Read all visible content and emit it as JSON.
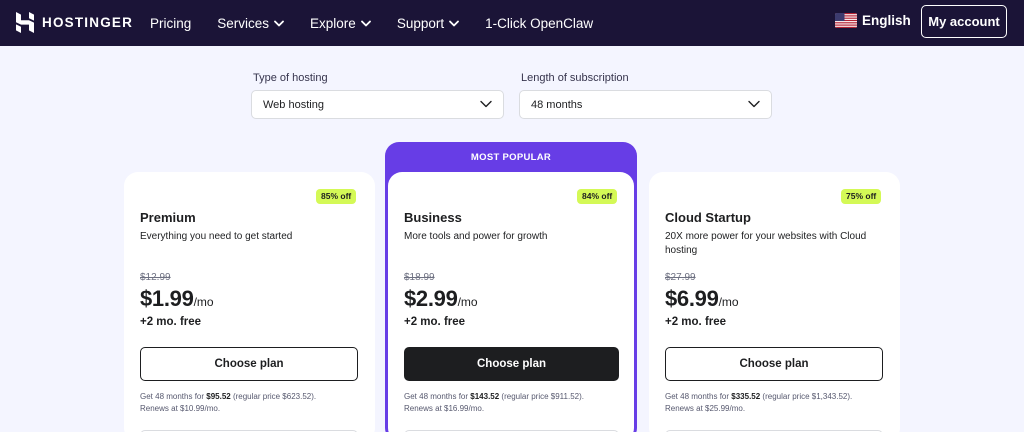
{
  "header": {
    "logo_text": "HOSTINGER",
    "nav": [
      {
        "label": "Pricing",
        "dropdown": false
      },
      {
        "label": "Services",
        "dropdown": true
      },
      {
        "label": "Explore",
        "dropdown": true
      },
      {
        "label": "Support",
        "dropdown": true
      },
      {
        "label": "1-Click OpenClaw",
        "dropdown": false
      }
    ],
    "language": "English",
    "account_button": "My account"
  },
  "filters": {
    "hosting_type": {
      "label": "Type of hosting",
      "value": "Web hosting"
    },
    "subscription": {
      "label": "Length of subscription",
      "value": "48 months"
    }
  },
  "popular_label": "MOST POPULAR",
  "plans": [
    {
      "badge": "85% off",
      "name": "Premium",
      "desc": "Everything you need to get started",
      "old_price": "$12.99",
      "price": "$1.99",
      "per": "/mo",
      "free": "+2 mo. free",
      "button": "Choose plan",
      "renew_pre": "Get 48 months for ",
      "renew_amount": "$95.52",
      "renew_post": " (regular price $623.52).",
      "renew_line2": "Renews at $10.99/mo."
    },
    {
      "badge": "84% off",
      "name": "Business",
      "desc": "More tools and power for growth",
      "old_price": "$18.99",
      "price": "$2.99",
      "per": "/mo",
      "free": "+2 mo. free",
      "button": "Choose plan",
      "renew_pre": "Get 48 months for ",
      "renew_amount": "$143.52",
      "renew_post": " (regular price $911.52).",
      "renew_line2": "Renews at $16.99/mo."
    },
    {
      "badge": "75% off",
      "name": "Cloud Startup",
      "desc": "20X more power for your websites with Cloud hosting",
      "old_price": "$27.99",
      "price": "$6.99",
      "per": "/mo",
      "free": "+2 mo. free",
      "button": "Choose plan",
      "renew_pre": "Get 48 months for ",
      "renew_amount": "$335.52",
      "renew_post": " (regular price $1,343.52).",
      "renew_line2": "Renews at $25.99/mo."
    }
  ],
  "colors": {
    "header_bg": "#1b1437",
    "page_bg": "#f4f5ff",
    "accent_purple": "#673de6",
    "badge_green": "#d4f956"
  }
}
